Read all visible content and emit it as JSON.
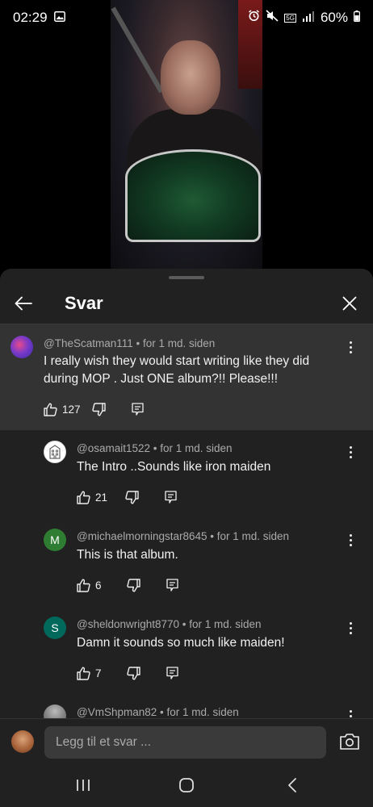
{
  "status_bar": {
    "time": "02:29",
    "network": "5G",
    "battery": "60%"
  },
  "video": {
    "label": "Video playing"
  },
  "sheet": {
    "title": "Svar"
  },
  "comments": [
    {
      "author": "@TheScatman111",
      "meta": " • for 1 md. siden",
      "text_line1": "I really wish they would start writing like they did",
      "text_line2": "during MOP . Just ONE album?!! Please!!!",
      "likes": "127",
      "avatar_letter": "",
      "avatar_color": "#6a5acd"
    },
    {
      "author": "@osamait1522",
      "meta": " • for 1 md. siden",
      "text_line1": "The Intro ..Sounds like iron maiden",
      "likes": "21",
      "avatar_letter": "",
      "avatar_color": "#ffffff"
    },
    {
      "author": "@michaelmorningstar8645",
      "meta": " • for 1 md. siden",
      "text_line1": "This is that album.",
      "likes": "6",
      "avatar_letter": "M",
      "avatar_color": "#2e7d32"
    },
    {
      "author": "@sheldonwright8770",
      "meta": " • for 1 md. siden",
      "text_line1": "Damn it sounds so much like maiden!",
      "likes": "7",
      "avatar_letter": "S",
      "avatar_color": "#00695c"
    },
    {
      "author": "@VmShpman82",
      "meta": " • for 1 md. siden",
      "avatar_letter": "",
      "avatar_color": "#888888"
    }
  ],
  "composer": {
    "placeholder": "Legg til et svar ..."
  },
  "icons": {
    "back": "arrow-left-icon",
    "close": "close-icon",
    "like": "thumbs-up-icon",
    "dislike": "thumbs-down-icon",
    "reply": "reply-icon",
    "more": "more-vert-icon",
    "camera": "camera-icon"
  }
}
